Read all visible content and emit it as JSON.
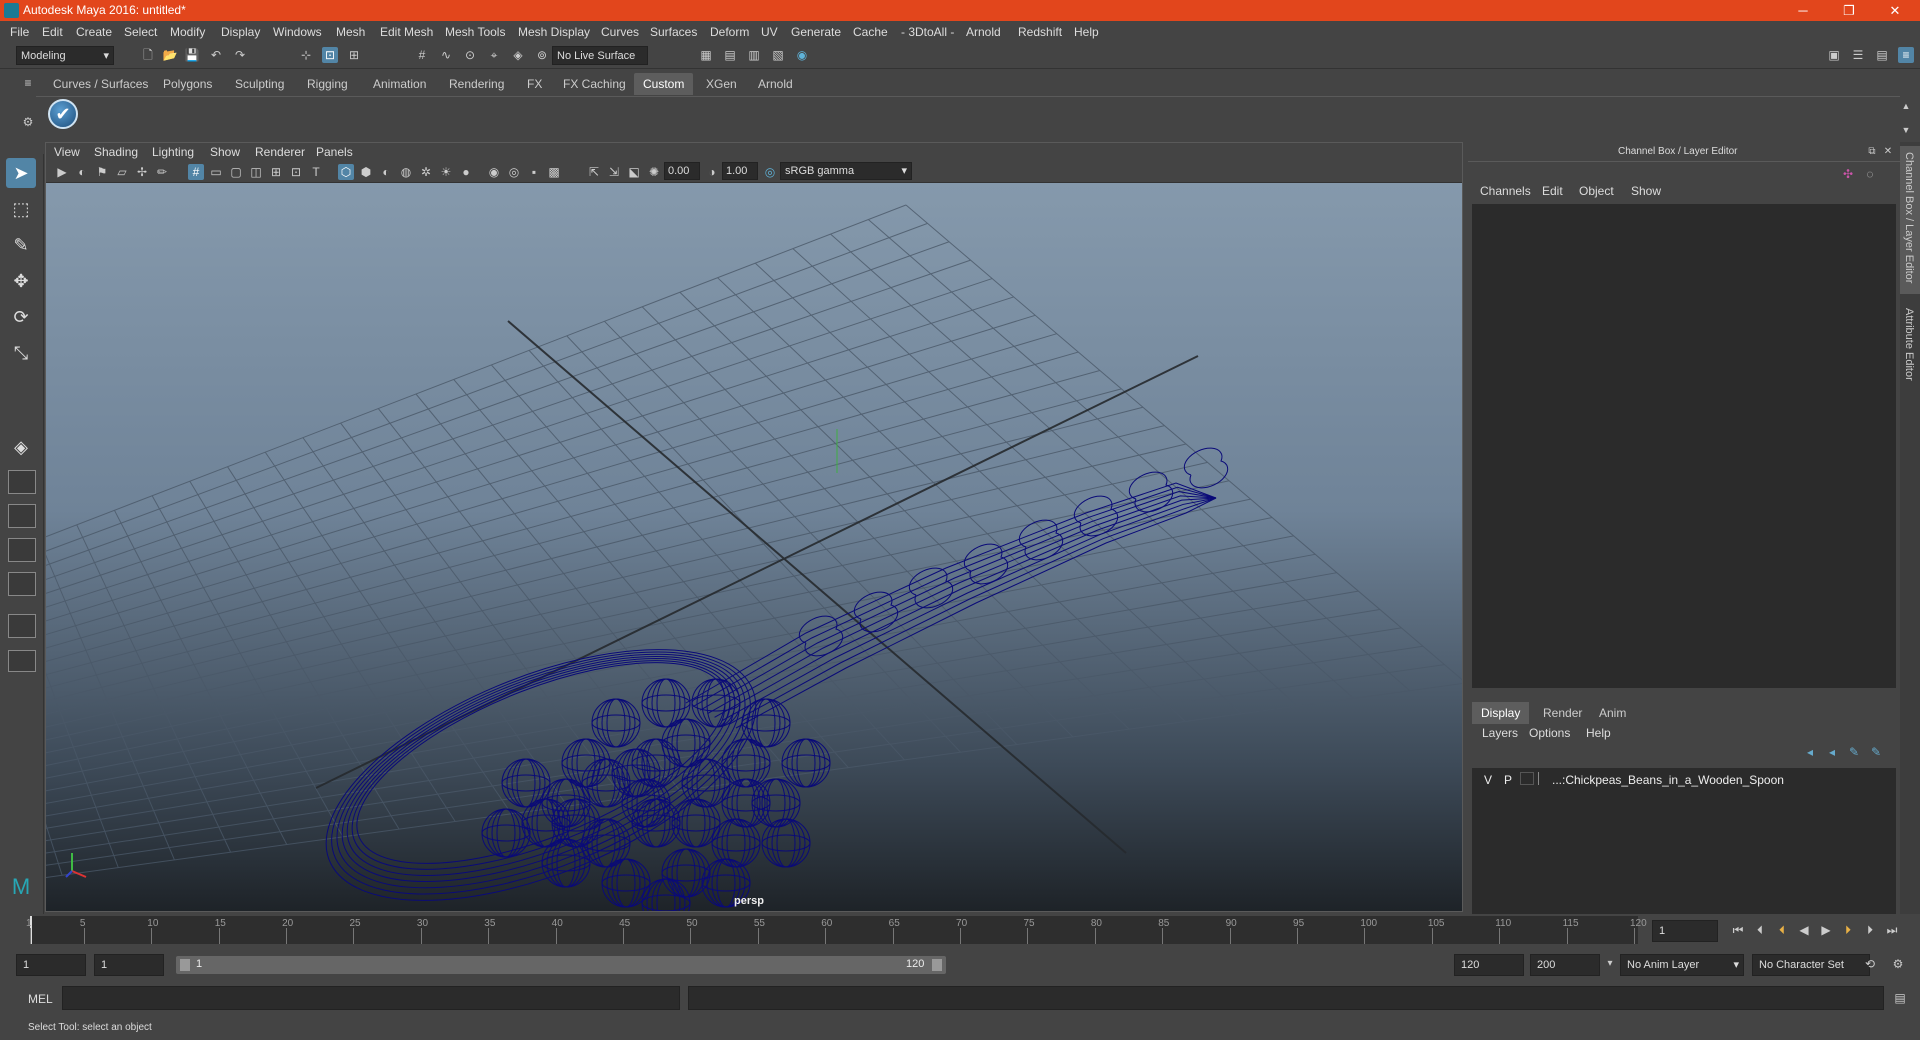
{
  "window": {
    "title": "Autodesk Maya 2016: untitled*",
    "minimize": "─",
    "restore": "❐",
    "close": "✕"
  },
  "menus": [
    "File",
    "Edit",
    "Create",
    "Select",
    "Modify",
    "Display",
    "Windows",
    "Mesh",
    "Edit Mesh",
    "Mesh Tools",
    "Mesh Display",
    "Curves",
    "Surfaces",
    "Deform",
    "UV",
    "Generate",
    "Cache",
    "- 3DtoAll -",
    "Arnold",
    "Redshift",
    "Help"
  ],
  "status_line": {
    "mode": "Modeling",
    "live_surface": "No Live Surface"
  },
  "shelf": {
    "tabs": [
      "Curves / Surfaces",
      "Polygons",
      "Sculpting",
      "Rigging",
      "Animation",
      "Rendering",
      "FX",
      "FX Caching",
      "Custom",
      "XGen",
      "Arnold"
    ],
    "active_tab": "Custom",
    "button_icon": "checkmark-icon"
  },
  "viewport": {
    "menu": [
      "View",
      "Shading",
      "Lighting",
      "Show",
      "Renderer",
      "Panels"
    ],
    "exposure": "0.00",
    "gamma": "1.00",
    "color_space": "sRGB gamma",
    "camera": "persp",
    "wire_color": "#0a0a78"
  },
  "channel_box": {
    "title": "Channel Box / Layer Editor",
    "menu": [
      "Channels",
      "Edit",
      "Object",
      "Show"
    ],
    "side_tabs": [
      "Channel Box / Layer Editor",
      "Attribute Editor"
    ]
  },
  "layer_editor": {
    "tabs": [
      "Display",
      "Render",
      "Anim"
    ],
    "active_tab": "Display",
    "menu": [
      "Layers",
      "Options",
      "Help"
    ],
    "layers": [
      {
        "visible": "V",
        "playback": "P",
        "name": "...:Chickpeas_Beans_in_a_Wooden_Spoon"
      }
    ]
  },
  "timeline": {
    "ticks": [
      "1",
      "5",
      "10",
      "15",
      "20",
      "25",
      "30",
      "35",
      "40",
      "45",
      "50",
      "55",
      "60",
      "65",
      "70",
      "75",
      "80",
      "85",
      "90",
      "95",
      "100",
      "105",
      "110",
      "115",
      "120"
    ],
    "current_frame": "1"
  },
  "range": {
    "start": "1",
    "playback_start": "1",
    "slider_start": "1",
    "slider_end": "120",
    "playback_end": "120",
    "end": "200",
    "anim_layer": "No Anim Layer",
    "char_set": "No Character Set"
  },
  "command_line": {
    "label": "MEL"
  },
  "help_line": "Select Tool: select an object"
}
